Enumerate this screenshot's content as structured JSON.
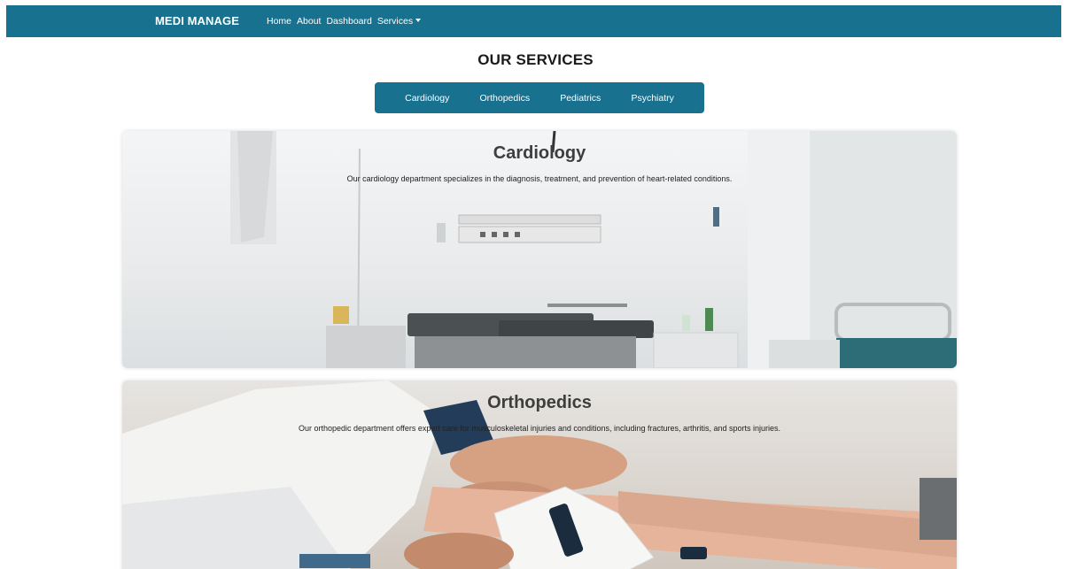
{
  "navbar": {
    "brand": "MEDI MANAGE",
    "links": [
      "Home",
      "About",
      "Dashboard",
      "Services"
    ]
  },
  "page": {
    "title": "OUR SERVICES"
  },
  "tabs": [
    "Cardiology",
    "Orthopedics",
    "Pediatrics",
    "Psychiatry"
  ],
  "services": [
    {
      "title": "Cardiology",
      "description": "Our cardiology department specializes in the diagnosis, treatment, and prevention of heart-related conditions."
    },
    {
      "title": "Orthopedics",
      "description": "Our orthopedic department offers expert care for musculoskeletal injuries and conditions, including fractures, arthritis, and sports injuries."
    }
  ],
  "colors": {
    "brand": "#17718f"
  }
}
